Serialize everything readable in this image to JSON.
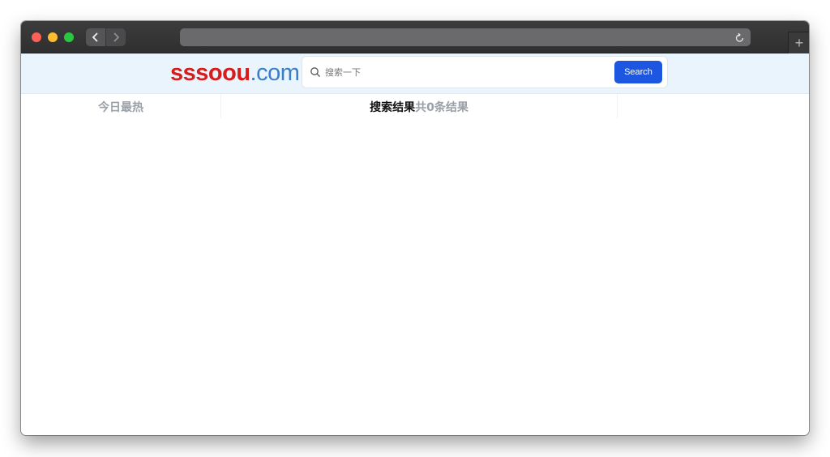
{
  "browser": {
    "new_tab_symbol": "+",
    "icons": [
      "back-arrow-icon",
      "forward-arrow-icon",
      "reload-icon",
      "plus-icon"
    ]
  },
  "site": {
    "logo_main": "sssoou",
    "logo_suffix": ".com",
    "colors": {
      "logo_main": "#d71c1c",
      "logo_suffix": "#3a7ec9",
      "accent": "#1d56e0"
    }
  },
  "search": {
    "placeholder": "搜索一下",
    "value": "",
    "button_label": "Search"
  },
  "sidebar": {
    "title": "今日最热"
  },
  "results": {
    "label": "搜索结果",
    "count_text": "共0条结果"
  }
}
